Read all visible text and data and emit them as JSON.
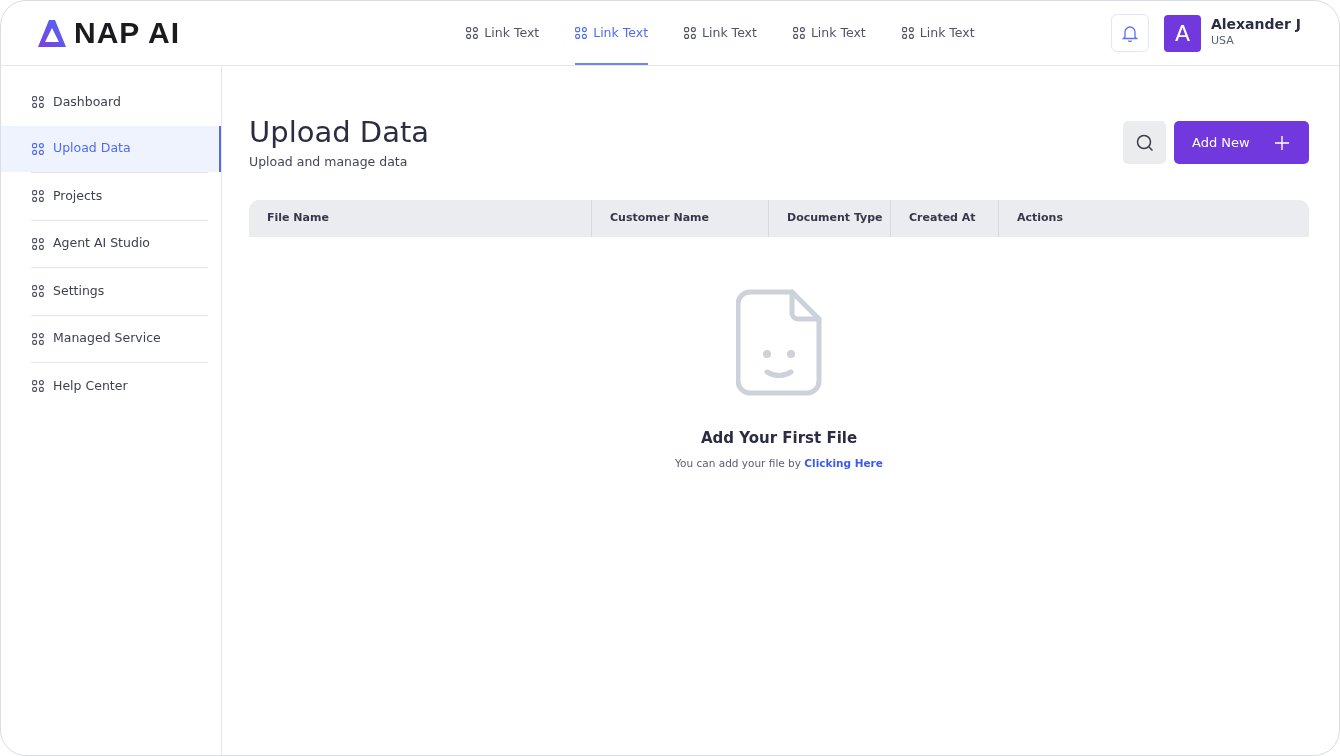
{
  "logo": {
    "text": "NAP AI"
  },
  "top_nav": [
    {
      "label": "Link Text",
      "selected": false
    },
    {
      "label": "Link Text",
      "selected": true
    },
    {
      "label": "Link Text",
      "selected": false
    },
    {
      "label": "Link Text",
      "selected": false
    },
    {
      "label": "Link Text",
      "selected": false
    }
  ],
  "user": {
    "initial": "A",
    "name": "Alexander J",
    "country": "USA"
  },
  "sidebar": {
    "items": [
      {
        "label": "Dashboard",
        "selected": false
      },
      {
        "label": "Upload Data",
        "selected": true
      },
      {
        "label": "Projects",
        "selected": false
      },
      {
        "label": "Agent AI Studio",
        "selected": false
      },
      {
        "label": "Settings",
        "selected": false
      },
      {
        "label": "Managed Service",
        "selected": false
      },
      {
        "label": "Help Center",
        "selected": false
      }
    ]
  },
  "page": {
    "title": "Upload Data",
    "subtitle": "Upload and manage data",
    "add_button": "Add New"
  },
  "table": {
    "columns": [
      "File Name",
      "Customer Name",
      "Document Type",
      "Created At",
      "Actions"
    ]
  },
  "empty_state": {
    "title": "Add Your First File",
    "text": "You can add your file by ",
    "link": "Clicking Here"
  }
}
